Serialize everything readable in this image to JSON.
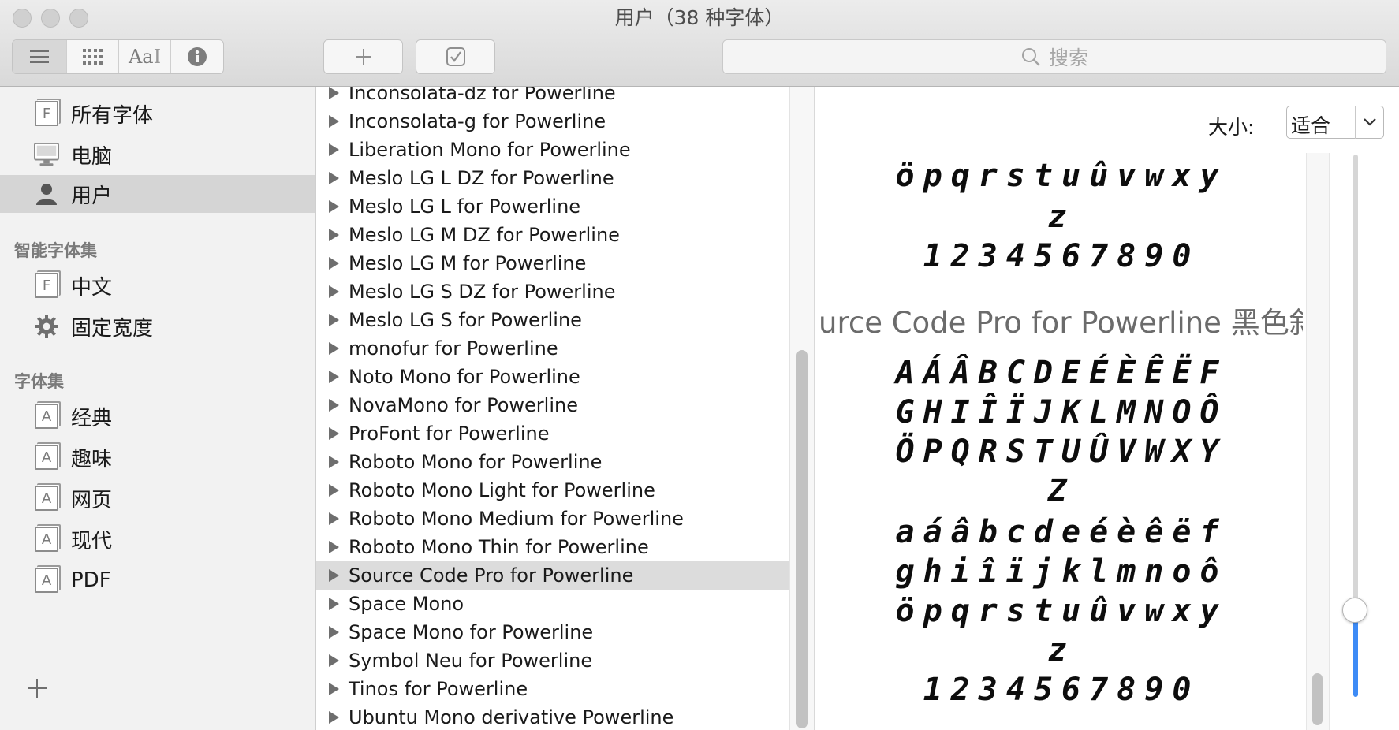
{
  "window": {
    "title": "用户（38 种字体）"
  },
  "toolbar": {
    "view_modes": [
      {
        "icon": "list-view-icon"
      },
      {
        "icon": "grid-view-icon"
      },
      {
        "icon": "sample-text-icon",
        "label": "Aa"
      },
      {
        "icon": "info-icon"
      }
    ],
    "add_icon": "plus-icon",
    "validate_icon": "checkbox-icon",
    "search": {
      "placeholder": "搜索"
    }
  },
  "sidebar": {
    "library_items": [
      {
        "label": "所有字体",
        "icon": "font-library-icon"
      },
      {
        "label": "电脑",
        "icon": "computer-icon"
      },
      {
        "label": "用户",
        "icon": "user-icon",
        "selected": true
      }
    ],
    "smart_header": "智能字体集",
    "smart_items": [
      {
        "label": "中文",
        "icon": "font-library-icon"
      },
      {
        "label": "固定宽度",
        "icon": "gear-icon"
      }
    ],
    "collections_header": "字体集",
    "collection_items": [
      {
        "label": "经典",
        "icon": "collection-icon"
      },
      {
        "label": "趣味",
        "icon": "collection-icon"
      },
      {
        "label": "网页",
        "icon": "collection-icon"
      },
      {
        "label": "现代",
        "icon": "collection-icon"
      },
      {
        "label": "PDF",
        "icon": "collection-icon"
      }
    ],
    "add_icon": "plus-icon"
  },
  "font_list": [
    "Inconsolata-dz for Powerline",
    "Inconsolata-g for Powerline",
    "Liberation Mono for Powerline",
    "Meslo LG L DZ for Powerline",
    "Meslo LG L for Powerline",
    "Meslo LG M DZ for Powerline",
    "Meslo LG M for Powerline",
    "Meslo LG S DZ for Powerline",
    "Meslo LG S for Powerline",
    "monofur for Powerline",
    "Noto Mono for Powerline",
    "NovaMono for Powerline",
    "ProFont for Powerline",
    "Roboto Mono for Powerline",
    "Roboto Mono Light for Powerline",
    "Roboto Mono Medium for Powerline",
    "Roboto Mono Thin for Powerline",
    "Source Code Pro for Powerline",
    "Space Mono",
    "Space Mono for Powerline",
    "Symbol Neu for Powerline",
    "Tinos for Powerline",
    "Ubuntu Mono derivative Powerline"
  ],
  "selected_font_index": 17,
  "preview": {
    "size_label": "大小:",
    "size_value": "适合",
    "top_lines": [
      "öpqrstuûvwxy",
      "z",
      "1234567890"
    ],
    "font_heading": "urce Code Pro for Powerline 黑色斜体",
    "lines": [
      "AÁÂBCDEÉÈÊËF",
      "GHIÎÏJKLMNOÔ",
      "ÖPQRSTUÛVWXY",
      "Z",
      "aáâbcdeéèêëf",
      "ghiîïjklmnoô",
      "öpqrstuûvwxy",
      "z",
      "1234567890"
    ],
    "size_slider_fraction": 0.16
  },
  "colors": {
    "accent": "#3d8bf6",
    "selection": "#d5d5d5"
  }
}
